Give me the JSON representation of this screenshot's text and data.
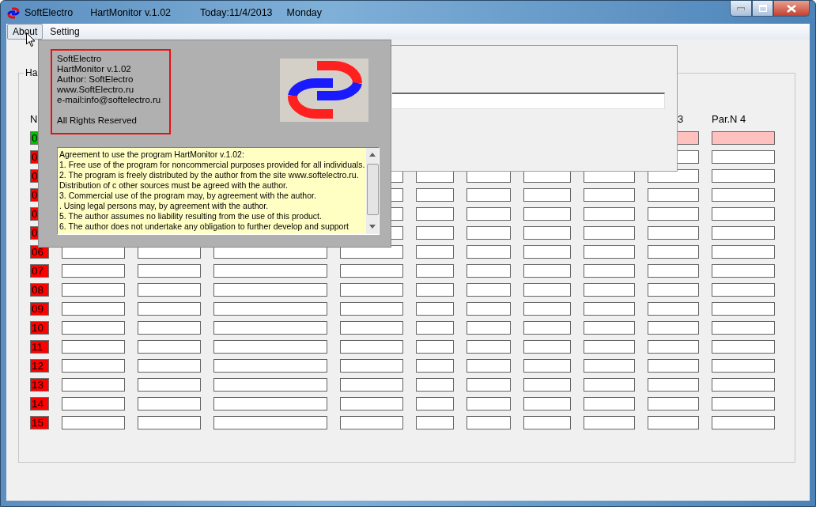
{
  "window": {
    "title_parts": [
      "SoftElectro",
      "HartMonitor v.1.02",
      "Today:11/4/2013",
      "Monday"
    ]
  },
  "menu": [
    {
      "label": "About",
      "selected": true
    },
    {
      "label": "Setting",
      "selected": false
    }
  ],
  "about_dialog": {
    "info_lines": [
      "SoftElectro",
      "HartMonitor v.1.02",
      "Author: SoftElectro",
      "www.SoftElectro.ru",
      "e-mail:info@softelectro.ru"
    ],
    "rights": "All Rights Reserved",
    "agreement_lines": [
      "Agreement to use the program HartMonitor v.1.02:",
      "1. Free use of the program for noncommercial purposes provided for all individuals.",
      "2. The program is freely distributed by the author from the site www.softelectro.ru.",
      "Distribution of c other sources must be agreed with the author.",
      "3. Commercial use of the program may, by agreement with the author.",
      ". Using legal persons may, by agreement with the author.",
      "5. The author assumes no liability resulting from the use of this product.",
      "6. The author does not undertake any obligation to further develop and support"
    ]
  },
  "group": {
    "title": "Ha"
  },
  "columns": [
    {
      "header": "N"
    },
    {},
    {},
    {},
    {},
    {},
    {},
    {},
    {},
    {
      "header": "3"
    },
    {
      "header": "Par.N 4"
    }
  ],
  "rows": [
    {
      "number": "0",
      "color": "#00c000",
      "active": true
    },
    {
      "number": "0",
      "color": "#ff0000",
      "active": false
    },
    {
      "number": "0",
      "color": "#ff0000",
      "active": false
    },
    {
      "number": "0",
      "color": "#ff0000",
      "active": false
    },
    {
      "number": "0",
      "color": "#ff0000",
      "active": false
    },
    {
      "number": "0",
      "color": "#ff0000",
      "active": false
    },
    {
      "number": "06",
      "color": "#ff0000",
      "active": false
    },
    {
      "number": "07",
      "color": "#ff0000",
      "active": false
    },
    {
      "number": "08",
      "color": "#ff0000",
      "active": false
    },
    {
      "number": "09",
      "color": "#ff0000",
      "active": false
    },
    {
      "number": "10",
      "color": "#ff0000",
      "active": false
    },
    {
      "number": "11",
      "color": "#ff0000",
      "active": false
    },
    {
      "number": "12",
      "color": "#ff0000",
      "active": false
    },
    {
      "number": "13",
      "color": "#ff0000",
      "active": false
    },
    {
      "number": "14",
      "color": "#ff0000",
      "active": false
    },
    {
      "number": "15",
      "color": "#ff0000",
      "active": false
    }
  ]
}
